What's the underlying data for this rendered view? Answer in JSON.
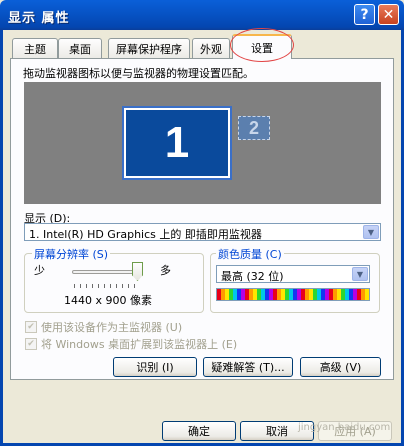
{
  "window": {
    "title": "显示 属性",
    "help_glyph": "?",
    "close_glyph": "✕"
  },
  "tabs": [
    {
      "label": "主题"
    },
    {
      "label": "桌面"
    },
    {
      "label": "屏幕保护程序"
    },
    {
      "label": "外观"
    },
    {
      "label": "设置",
      "active": true
    }
  ],
  "settings": {
    "description": "拖动监视器图标以便与监视器的物理设置匹配。",
    "monitors": [
      {
        "number": "1"
      },
      {
        "number": "2"
      }
    ],
    "display_label": "显示 (D):",
    "display_value": "1. Intel(R) HD Graphics 上的 即插即用监视器",
    "resolution": {
      "title": "屏幕分辨率 (S)",
      "min_label": "少",
      "max_label": "多",
      "value": "1440 x 900 像素",
      "slider_level": 1.0
    },
    "color_quality": {
      "title": "颜色质量 (C)",
      "value": "最高 (32 位)"
    },
    "checkboxes": [
      {
        "label": "使用该设备作为主监视器 (U)",
        "checked": true,
        "enabled": false
      },
      {
        "label": "将 Windows 桌面扩展到该监视器上 (E)",
        "checked": true,
        "enabled": false
      }
    ],
    "buttons": {
      "identify": "识别 (I)",
      "troubleshoot": "疑难解答 (T)...",
      "advanced": "高级 (V)"
    }
  },
  "footer": {
    "ok": "确定",
    "cancel": "取消",
    "apply": "应用 (A)",
    "watermark": "jingyan.baidu.com"
  },
  "colors": {
    "title_bar": "#0753c5",
    "group_title": "#0046d5",
    "monitor": "#0a4a9c",
    "highlight_circle": "#e24646"
  }
}
